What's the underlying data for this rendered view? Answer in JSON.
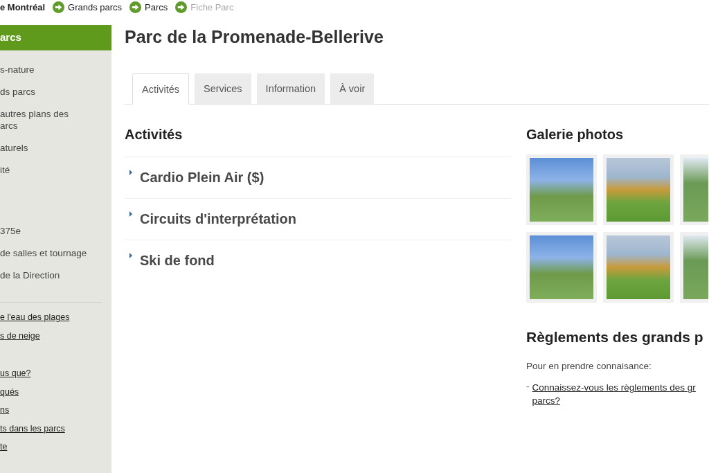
{
  "breadcrumb": [
    {
      "label": "e Montréal",
      "current": false,
      "kind": "home"
    },
    {
      "label": "Grands parcs",
      "current": false,
      "kind": "link"
    },
    {
      "label": "Parcs",
      "current": false,
      "kind": "link"
    },
    {
      "label": "Fiche Parc",
      "current": true,
      "kind": "link"
    }
  ],
  "sidebar": {
    "title": "arcs",
    "item_groups": [
      [
        {
          "label": "s-nature"
        },
        {
          "label": "ds parcs"
        },
        {
          "label": "autres plans des\narcs"
        },
        {
          "label": "aturels"
        },
        {
          "label": "ité"
        }
      ],
      [
        {
          "label": "375e"
        },
        {
          "label": "de salles et tournage"
        },
        {
          "label": "de la Direction"
        }
      ]
    ],
    "link_groups": [
      [
        {
          "label": "e l'eau des plages"
        },
        {
          "label": "s de neige"
        }
      ],
      [
        {
          "label": "us que?"
        },
        {
          "label": "qués"
        },
        {
          "label": "ns"
        },
        {
          "label": "ts dans les parcs"
        },
        {
          "label": "te"
        }
      ]
    ]
  },
  "title": "Parc de la Promenade-Bellerive",
  "tabs": [
    {
      "label": "Activités",
      "selected": true
    },
    {
      "label": "Services",
      "selected": false
    },
    {
      "label": "Information",
      "selected": false
    },
    {
      "label": "À voir",
      "selected": false
    }
  ],
  "activities": {
    "heading": "Activités",
    "items": [
      "Cardio Plein Air ($)",
      "Circuits d'interprétation",
      "Ski de fond"
    ]
  },
  "gallery": {
    "heading": "Galerie photos"
  },
  "rules": {
    "bullet": "-",
    "heading": "Règlements des grands p",
    "intro": "Pour en prendre connaisance:",
    "link": "Connaissez-vous les règlements des gr parcs?"
  }
}
